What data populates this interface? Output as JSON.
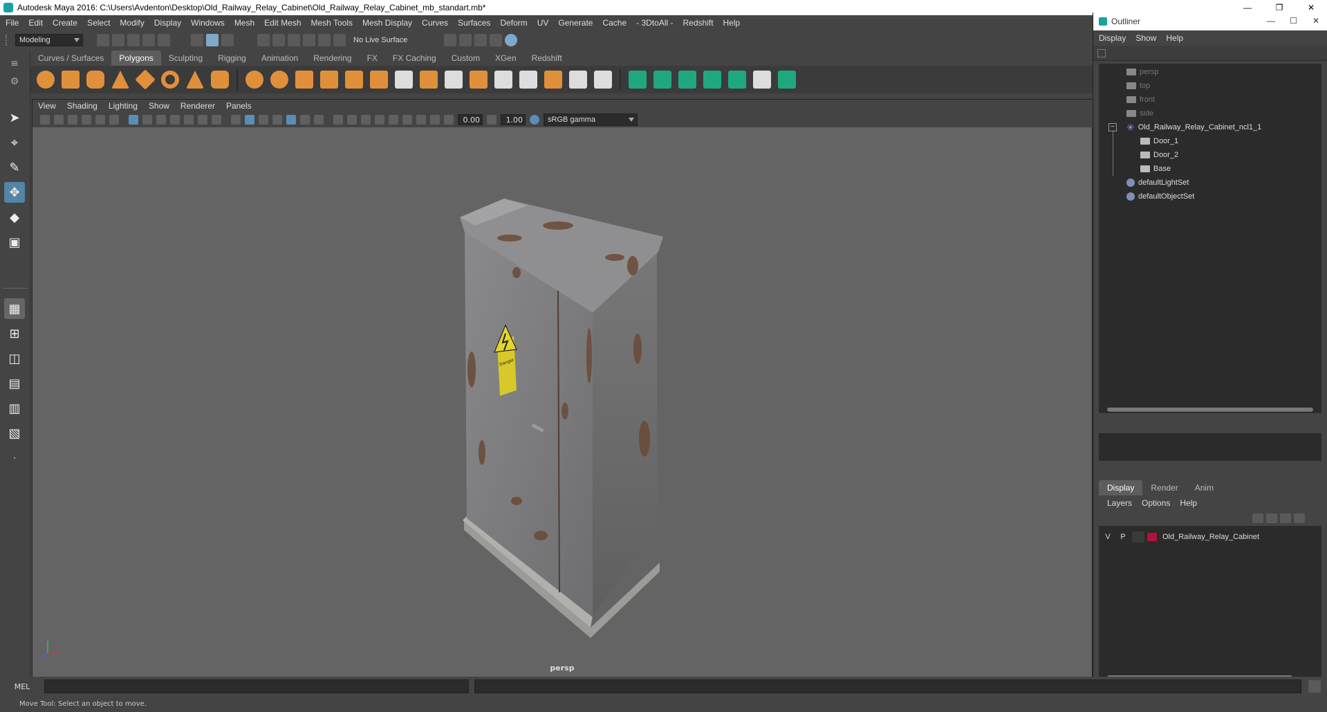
{
  "window": {
    "title": "Autodesk Maya 2016: C:\\Users\\Avdenton\\Desktop\\Old_Railway_Relay_Cabinet\\Old_Railway_Relay_Cabinet_mb_standart.mb*",
    "minimize": "—",
    "maximize": "❐",
    "close": "✕"
  },
  "menubar": [
    "File",
    "Edit",
    "Create",
    "Select",
    "Modify",
    "Display",
    "Windows",
    "Mesh",
    "Edit Mesh",
    "Mesh Tools",
    "Mesh Display",
    "Curves",
    "Surfaces",
    "Deform",
    "UV",
    "Generate",
    "Cache",
    "- 3DtoAll -",
    "Redshift",
    "Help"
  ],
  "statusline": {
    "mode": "Modeling",
    "live_surface": "No Live Surface"
  },
  "shelf_tabs": [
    "Curves / Surfaces",
    "Polygons",
    "Sculpting",
    "Rigging",
    "Animation",
    "Rendering",
    "FX",
    "FX Caching",
    "Custom",
    "XGen",
    "Redshift"
  ],
  "shelf_active": "Polygons",
  "viewport": {
    "menu": [
      "View",
      "Shading",
      "Lighting",
      "Show",
      "Renderer",
      "Panels"
    ],
    "exposure": "0.00",
    "gamma": "1.00",
    "color_space": "sRGB gamma",
    "camera_label": "persp",
    "warning_sign_text": "Danger"
  },
  "outliner": {
    "title": "Outliner",
    "menu": [
      "Display",
      "Show",
      "Help"
    ],
    "items": {
      "persp": "persp",
      "top": "top",
      "front": "front",
      "side": "side",
      "group": "Old_Railway_Relay_Cabinet_ncl1_1",
      "door1": "Door_1",
      "door2": "Door_2",
      "base": "Base",
      "lightset": "defaultLightSet",
      "objectset": "defaultObjectSet"
    },
    "collapse_symbol": "−"
  },
  "layers": {
    "tabs": [
      "Display",
      "Render",
      "Anim"
    ],
    "active_tab": "Display",
    "menu": [
      "Layers",
      "Options",
      "Help"
    ],
    "row": {
      "v": "V",
      "p": "P",
      "name": "Old_Railway_Relay_Cabinet",
      "color": "#b3123a"
    }
  },
  "cmdline": {
    "label": "MEL"
  },
  "helpline": "Move Tool: Select an object to move."
}
